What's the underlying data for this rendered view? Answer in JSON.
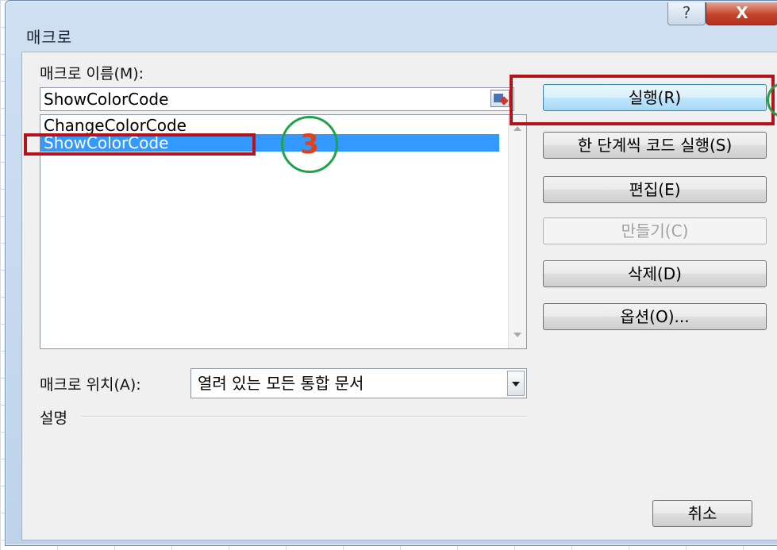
{
  "window": {
    "title": "매크로",
    "help_glyph": "?",
    "close_glyph": "X"
  },
  "macro_name": {
    "label": "매크로 이름(M):",
    "value": "ShowColorCode"
  },
  "macro_list": {
    "items": [
      {
        "label": "ChangeColorCode",
        "selected": false
      },
      {
        "label": "ShowColorCode",
        "selected": true
      }
    ]
  },
  "location": {
    "label": "매크로 위치(A):",
    "value": "열려 있는 모든 통합 문서"
  },
  "description": {
    "label": "설명"
  },
  "buttons": {
    "run": "실행(R)",
    "step_into": "한 단계씩 코드 실행(S)",
    "edit": "편집(E)",
    "create": "만들기(C)",
    "delete": "삭제(D)",
    "options": "옵션(O)...",
    "cancel": "취소"
  },
  "annotations": {
    "step_number": "3",
    "highlight_color": "#b5121b",
    "circle_color": "#1fa24a"
  },
  "colors": {
    "selection": "#3399ff",
    "close_button": "#c6442c"
  }
}
